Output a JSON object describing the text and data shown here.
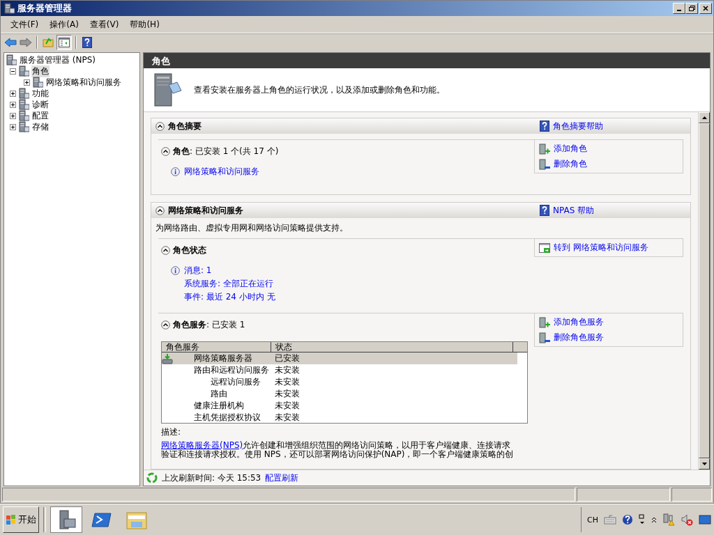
{
  "window": {
    "title": "服务器管理器"
  },
  "menu": [
    "文件(F)",
    "操作(A)",
    "查看(V)",
    "帮助(H)"
  ],
  "tree": {
    "label": "服务器管理器 (NPS)",
    "children": [
      {
        "label": "角色",
        "expanded": true,
        "selected": true,
        "children": [
          {
            "label": "网络策略和访问服务",
            "expanded": false,
            "selected": false
          }
        ]
      },
      {
        "label": "功能",
        "expanded": false,
        "selected": false
      },
      {
        "label": "诊断",
        "expanded": false,
        "selected": false
      },
      {
        "label": "配置",
        "expanded": false,
        "selected": false
      },
      {
        "label": "存储",
        "expanded": false,
        "selected": false
      }
    ]
  },
  "content": {
    "header": "角色",
    "intro": "查看安装在服务器上角色的运行状况，以及添加或删除角色和功能。",
    "sections": [
      {
        "title": "角色摘要",
        "help": "角色摘要帮助",
        "blocks": [
          {
            "kind": "list",
            "title": "**角色**: 已安装 1 个(共 17 个)",
            "lines": [
              "网络策略和访问服务"
            ],
            "actions": [
              "添加角色",
              "删除角色"
            ]
          }
        ]
      },
      {
        "title": "网络策略和访问服务",
        "help": "NPAS 帮助",
        "description": "为网络路由、虚拟专用网和网络访问策略提供支持。",
        "blocks": [
          {
            "kind": "list",
            "title": "**角色状态**",
            "lines": [
              "消息: 1",
              "系统服务: 全部正在运行",
              "事件: 最近 24 小时内 无"
            ],
            "actions": [
              "转到 网络策略和访问服务"
            ]
          },
          {
            "kind": "table",
            "title": "**角色服务**: 已安装 1",
            "actions": [
              "添加角色服务",
              "删除角色服务"
            ],
            "columns": [
              "角色服务",
              "状态"
            ],
            "rows": [
              {
                "name": "网络策略服务器",
                "status": "已安装",
                "selected": true,
                "installed": true
              },
              {
                "name": "路由和远程访问服务",
                "status": "未安装",
                "selected": false,
                "installed": false,
                "children": [
                  {
                    "name": "远程访问服务",
                    "status": "未安装",
                    "selected": false,
                    "installed": false
                  },
                  {
                    "name": "路由",
                    "status": "未安装",
                    "selected": false,
                    "installed": false
                  }
                ]
              },
              {
                "name": "健康注册机构",
                "status": "未安装",
                "selected": false,
                "installed": false
              },
              {
                "name": "主机凭据授权协议",
                "status": "未安装",
                "selected": false,
                "installed": false
              }
            ],
            "description_label": "描述:",
            "description": {
              "link": "网络策略服务器(NPS)",
              "text": "允许创建和增强组织范围的网络访问策略，以用于客户端健康、连接请求",
              "more": "验证和连接请求授权。使用 NPS，还可以部署网络访问保护(NAP)，即一个客户端健康策略的创"
            }
          }
        ]
      }
    ],
    "footer": {
      "text": "上次刷新时间: 今天 15:53",
      "link": "配置刷新"
    }
  },
  "taskbar": {
    "start": "开始",
    "language": "CH"
  }
}
